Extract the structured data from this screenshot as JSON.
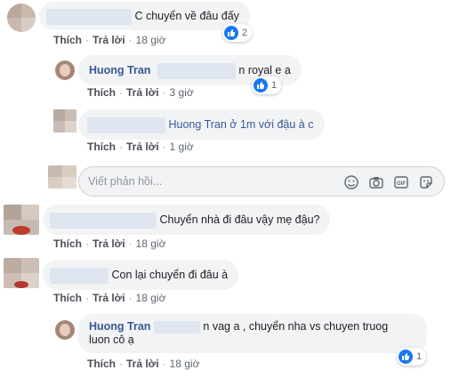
{
  "comments": [
    {
      "text": "C chuyển về đâu đấy",
      "actions": {
        "like": "Thích",
        "reply": "Trả lời",
        "time": "18 giờ"
      },
      "reaction_count": "2"
    },
    {
      "author": "Huong Tran",
      "text": "n royal e a",
      "actions": {
        "like": "Thích",
        "reply": "Trả lời",
        "time": "3 giờ"
      },
      "reaction_count": "1"
    },
    {
      "text": "Huong Tran ở 1m với đậu à c",
      "actions": {
        "like": "Thích",
        "reply": "Trả lời",
        "time": "1 giờ"
      }
    },
    {
      "text": "Chuyển nhà đi đâu vậy mẹ đậu?",
      "actions": {
        "like": "Thích",
        "reply": "Trả lời",
        "time": "18 giờ"
      }
    },
    {
      "text": "Con lại chuyển đi đâu à",
      "actions": {
        "like": "Thích",
        "reply": "Trả lời",
        "time": "18 giờ"
      }
    },
    {
      "author": "Huong Tran",
      "text_line1": "n vag a , chuyển nha vs chuyen truog",
      "text_line2": "luon cô ạ",
      "actions": {
        "like": "Thích",
        "reply": "Trả lời",
        "time": "18 giờ"
      },
      "reaction_count": "1"
    }
  ],
  "reply_box": {
    "placeholder": "Viết phản hồi...",
    "icons": [
      "emoji-icon",
      "camera-icon",
      "gif-icon",
      "sticker-icon"
    ]
  },
  "colors": {
    "name": "#385898",
    "bubble": "#f2f3f5",
    "like": "#1877f2",
    "meta": "#606770"
  }
}
